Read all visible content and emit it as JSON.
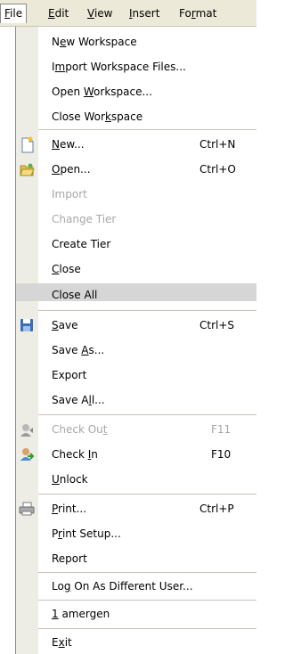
{
  "menubar": {
    "items": [
      {
        "prefix": "",
        "accel": "F",
        "suffix": "ile"
      },
      {
        "prefix": "",
        "accel": "E",
        "suffix": "dit"
      },
      {
        "prefix": "",
        "accel": "V",
        "suffix": "iew"
      },
      {
        "prefix": "",
        "accel": "I",
        "suffix": "nsert"
      },
      {
        "prefix": "Fo",
        "accel": "r",
        "suffix": "mat"
      }
    ]
  },
  "file_menu": {
    "new_workspace": {
      "prefix": "N",
      "accel": "e",
      "suffix": "w Workspace"
    },
    "import_workspace": {
      "prefix": "I",
      "accel": "m",
      "suffix": "port Workspace Files..."
    },
    "open_workspace": {
      "prefix": "Open ",
      "accel": "W",
      "suffix": "orkspace..."
    },
    "close_workspace": {
      "prefix": "Close Wor",
      "accel": "k",
      "suffix": "space"
    },
    "new": {
      "prefix": "",
      "accel": "N",
      "suffix": "ew...",
      "shortcut": "Ctrl+N"
    },
    "open": {
      "prefix": "",
      "accel": "O",
      "suffix": "pen...",
      "shortcut": "Ctrl+O"
    },
    "import": {
      "label": "Import"
    },
    "change_tier": {
      "label": "Change Tier"
    },
    "create_tier": {
      "label": "Create Tier"
    },
    "close": {
      "prefix": "",
      "accel": "C",
      "suffix": "lose"
    },
    "close_all": {
      "label": "Close All"
    },
    "save": {
      "prefix": "",
      "accel": "S",
      "suffix": "ave",
      "shortcut": "Ctrl+S"
    },
    "save_as": {
      "prefix": "Save ",
      "accel": "A",
      "suffix": "s..."
    },
    "export": {
      "label": "Export"
    },
    "save_all": {
      "prefix": "Save A",
      "accel": "l",
      "suffix": "l..."
    },
    "check_out": {
      "prefix": "Check Ou",
      "accel": "t",
      "suffix": "",
      "shortcut": "F11"
    },
    "check_in": {
      "prefix": "Check ",
      "accel": "I",
      "suffix": "n",
      "shortcut": "F10"
    },
    "unlock": {
      "prefix": "",
      "accel": "U",
      "suffix": "nlock"
    },
    "print": {
      "prefix": "",
      "accel": "P",
      "suffix": "rint...",
      "shortcut": "Ctrl+P"
    },
    "print_setup": {
      "prefix": "P",
      "accel": "r",
      "suffix": "int Setup..."
    },
    "report": {
      "label": "Report"
    },
    "log_on": {
      "prefix": "Lo",
      "accel": "g",
      "suffix": " On As Different User..."
    },
    "recent_1": {
      "prefix": "",
      "accel": "1",
      "suffix": " amergen"
    },
    "exit": {
      "prefix": "E",
      "accel": "x",
      "suffix": "it"
    }
  },
  "colors": {
    "gutter": "#eeede5",
    "disabled_text": "#a7a6aa",
    "menubar_bg": "#ece9d8"
  },
  "icons": {
    "new": "new-document-icon",
    "open": "open-folder-icon",
    "save": "save-disk-icon",
    "check_out": "check-out-icon",
    "check_in": "check-in-icon",
    "print": "printer-icon"
  }
}
